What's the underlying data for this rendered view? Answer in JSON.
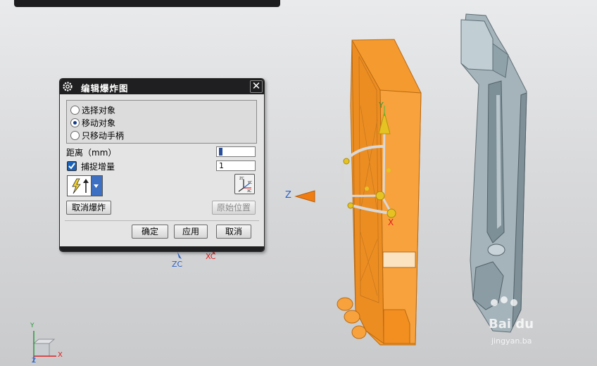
{
  "dialog": {
    "title": "编辑爆炸图",
    "close_label": "✕",
    "radio_options": [
      "选择对象",
      "移动对象",
      "只移动手柄"
    ],
    "selected_option": "移动对象",
    "distance": {
      "label": "距离（mm）",
      "value": "0"
    },
    "snap": {
      "label": "捕捉增量",
      "checked": true,
      "value": "1"
    },
    "cancel_explode_label": "取消爆炸",
    "original_position_label": "原始位置",
    "ok_label": "确定",
    "apply_label": "应用",
    "cancel_label": "取消"
  },
  "viewport": {
    "handle_labels": {
      "z": "Z",
      "y": "Y",
      "x": "X"
    },
    "wcs_labels": {
      "zc": "ZC",
      "xc": "XC"
    },
    "triad_labels": {
      "y": "Y",
      "x": "X",
      "z": "Z"
    },
    "colors": {
      "part_orange": "#f59a2e",
      "part_grey": "#a9b7be",
      "handle_orange": "#f07d12",
      "handle_yellow": "#e6c223",
      "blue_axis": "#2a62c7",
      "red_axis": "#e02020"
    }
  },
  "watermark": {
    "text": "Bai du",
    "sub": "jingyan.ba"
  }
}
